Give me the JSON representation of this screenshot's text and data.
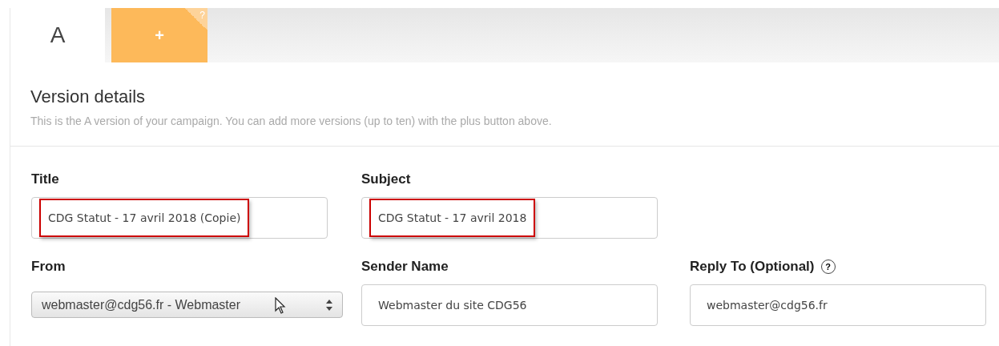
{
  "tabs": [
    {
      "label": "A",
      "kind": "version",
      "selected": true
    },
    {
      "label": "+",
      "kind": "add",
      "selected": false,
      "help": "?"
    }
  ],
  "section": {
    "title": "Version details",
    "description": "This is the A version of your campaign. You can add more versions (up to ten) with the plus button above."
  },
  "fields": [
    {
      "label": "Title",
      "kind": "text",
      "value": "CDG Statut - 17 avril 2018 (Copie)",
      "highlighted": true
    },
    {
      "label": "Subject",
      "kind": "text",
      "value": "CDG Statut - 17 avril 2018",
      "highlighted": true
    },
    {
      "label": "From",
      "kind": "select",
      "value": "webmaster@cdg56.fr - Webmaster",
      "highlighted": false
    },
    {
      "label": "Sender Name",
      "kind": "text",
      "value": "Webmaster du site CDG56",
      "highlighted": false
    },
    {
      "label": "Reply To (Optional)",
      "kind": "text",
      "value": "webmaster@cdg56.fr",
      "highlighted": false,
      "help": "?"
    }
  ]
}
